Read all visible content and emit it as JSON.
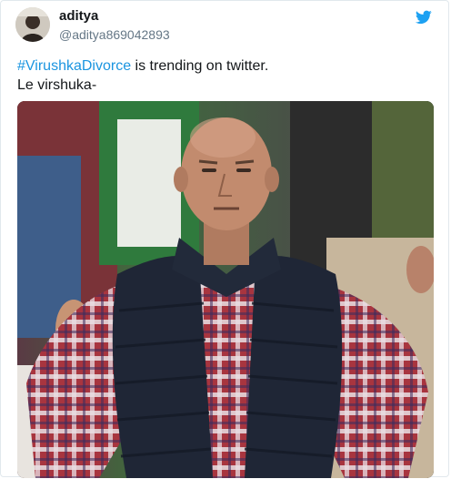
{
  "user": {
    "display_name": "aditya",
    "handle": "@aditya869042893"
  },
  "icons": {
    "logo": "twitter-bird-icon",
    "brand_color": "#1da1f2",
    "link_color": "#1b95e0"
  },
  "tweet": {
    "hashtag": "#VirushkaDivorce",
    "line1_rest": " is trending on twitter.",
    "line2": "Le virshuka-"
  }
}
